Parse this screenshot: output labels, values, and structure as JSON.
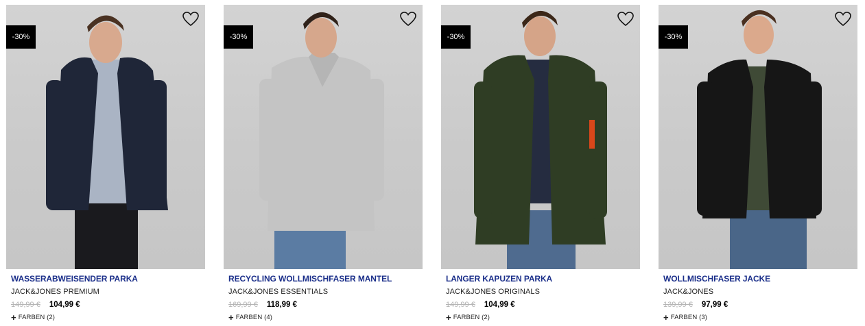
{
  "products": [
    {
      "discount": "-30%",
      "name": "WASSERABWEISENDER PARKA",
      "brand": "JACK&JONES PREMIUM",
      "old_price": "149,99 €",
      "new_price": "104,99 €",
      "colors_label": "FARBEN",
      "colors_count": "(2)",
      "coat_color": "#1f2638",
      "inner_color": "#aab4c4",
      "pants_color": "#1a1a1e"
    },
    {
      "discount": "-30%",
      "name": "RECYCLING WOLLMISCHFASER MANTEL",
      "brand": "JACK&JONES ESSENTIALS",
      "old_price": "169,99 €",
      "new_price": "118,99 €",
      "colors_label": "FARBEN",
      "colors_count": "(4)",
      "coat_color": "#c4c4c4",
      "inner_color": "#b5b5b5",
      "pants_color": "#5b7ca3"
    },
    {
      "discount": "-30%",
      "name": "LANGER KAPUZEN PARKA",
      "brand": "JACK&JONES ORIGINALS",
      "old_price": "149,99 €",
      "new_price": "104,99 €",
      "colors_label": "FARBEN",
      "colors_count": "(2)",
      "coat_color": "#2f3d24",
      "inner_color": "#252c40",
      "pants_color": "#4f6b8f"
    },
    {
      "discount": "-30%",
      "name": "WOLLMISCHFASER JACKE",
      "brand": "JACK&JONES",
      "old_price": "139,99 €",
      "new_price": "97,99 €",
      "colors_label": "FARBEN",
      "colors_count": "(3)",
      "coat_color": "#161616",
      "inner_color": "#3f4a36",
      "pants_color": "#4a6688"
    }
  ]
}
